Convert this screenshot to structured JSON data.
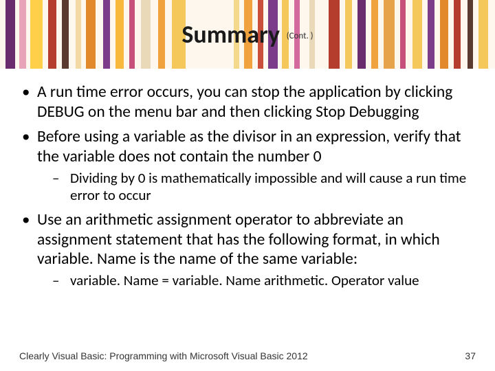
{
  "title": "Summary",
  "cont": "(Cont. )",
  "bullets": [
    {
      "text": "A run time error occurs, you can stop the application by clicking DEBUG on the menu bar and then clicking Stop Debugging"
    },
    {
      "text": "Before using a variable as the divisor in an expression, verify that the variable does not contain the number 0",
      "sub": [
        "Dividing by 0 is mathematically impossible and will cause a run time error to occur"
      ]
    },
    {
      "text": "Use an arithmetic assignment operator to abbreviate an assignment statement that has the following format, in which variable. Name is the name of the same variable:",
      "sub": [
        "variable. Name = variable. Name arithmetic. Operator value"
      ]
    }
  ],
  "footer": "Clearly Visual Basic: Programming with Microsoft Visual Basic 2012",
  "pagenum": "37"
}
